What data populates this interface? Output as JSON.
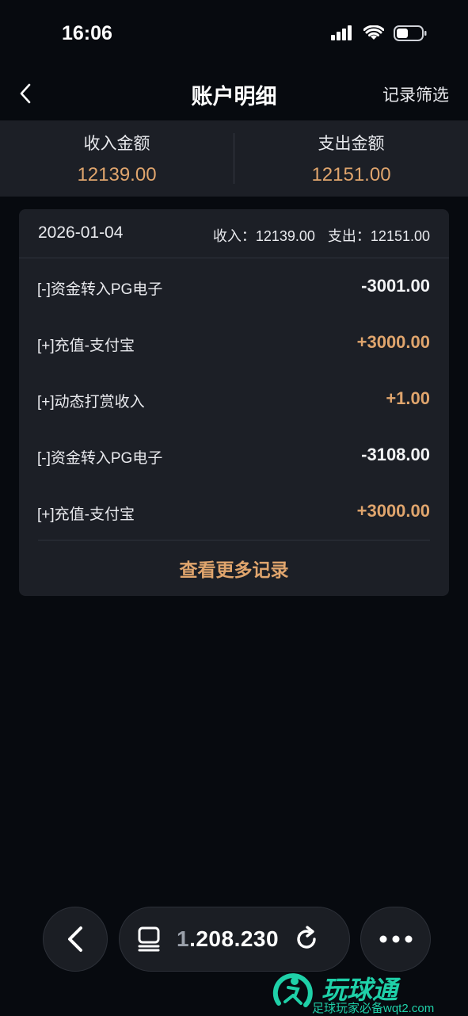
{
  "status": {
    "time": "16:06",
    "icons": [
      "signal-icon",
      "wifi-icon",
      "battery-icon"
    ]
  },
  "header": {
    "title": "账户明细",
    "filter_label": "记录筛选"
  },
  "summary": {
    "income_label": "收入金额",
    "income_value": "12139.00",
    "expense_label": "支出金额",
    "expense_value": "12151.00"
  },
  "card": {
    "date": "2026-01-04",
    "income_text": "收入：12139.00",
    "expense_text": "支出：12151.00",
    "rows": [
      {
        "label": "[-]资金转入PG电子",
        "amount": "-3001.00",
        "type": "neg"
      },
      {
        "label": "[+]充值-支付宝",
        "amount": "+3000.00",
        "type": "pos"
      },
      {
        "label": "[+]动态打赏收入",
        "amount": "+1.00",
        "type": "pos"
      },
      {
        "label": "[-]资金转入PG电子",
        "amount": "-3108.00",
        "type": "neg"
      },
      {
        "label": "[+]充值-支付宝",
        "amount": "+3000.00",
        "type": "pos"
      }
    ],
    "more_label": "查看更多记录"
  },
  "browser": {
    "address_dim": "1",
    "address_rest": ".208.230"
  },
  "watermark": {
    "title": "玩球通",
    "subtitle": "足球玩家必备wqt2.com"
  },
  "colors": {
    "accent": "#e0a56d",
    "background": "#070a0f",
    "panel": "#1c1f26",
    "watermark": "#1fd0a8"
  }
}
